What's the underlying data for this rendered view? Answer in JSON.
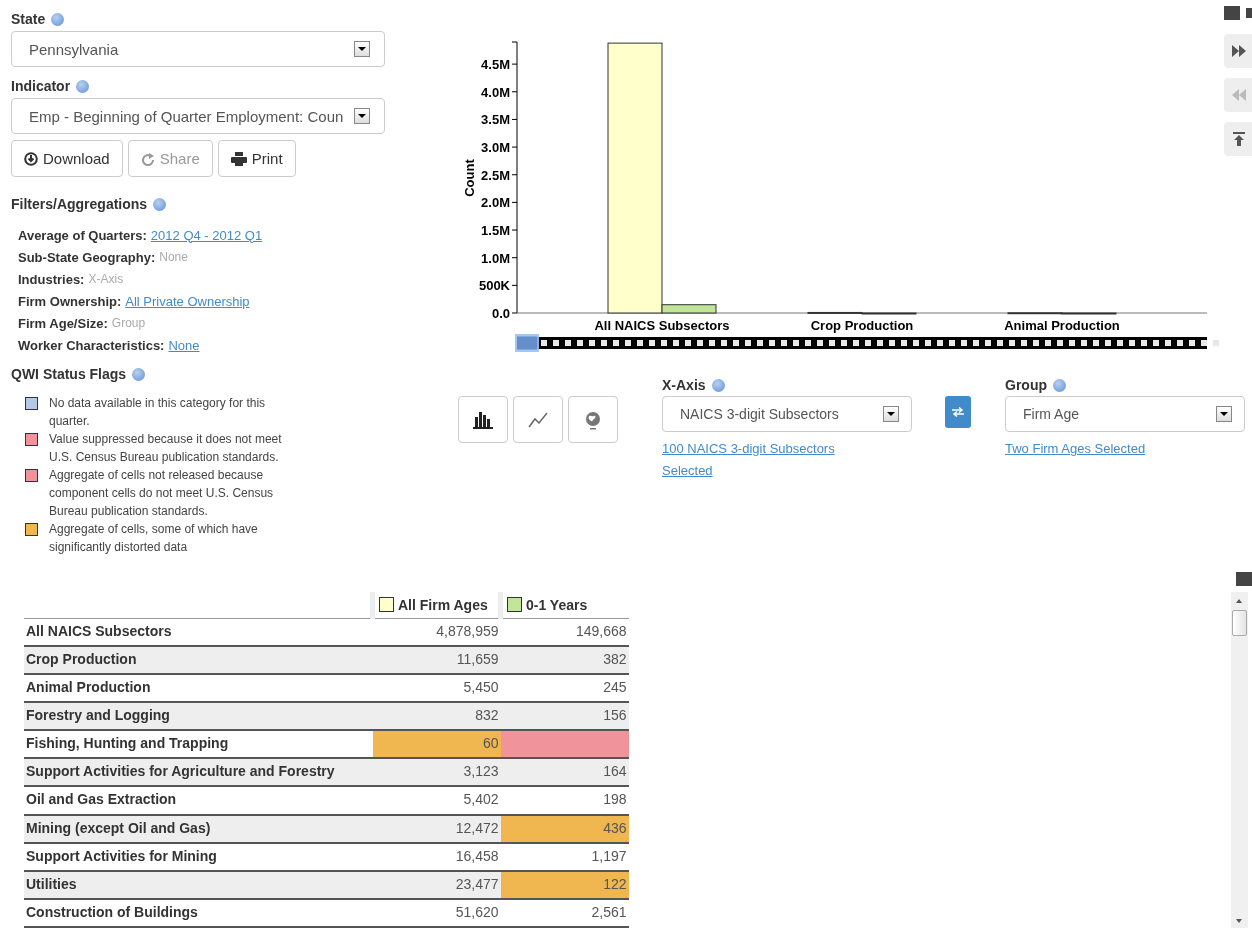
{
  "state_select": {
    "label": "State",
    "value": "Pennsylvania"
  },
  "indicator_select": {
    "label": "Indicator",
    "value": "Emp - Beginning of Quarter Employment: Coun"
  },
  "actions": [
    {
      "label": "Download",
      "kind": "download",
      "disabled": false
    },
    {
      "label": "Share",
      "kind": "share",
      "disabled": true
    },
    {
      "label": "Print",
      "kind": "print",
      "disabled": false
    }
  ],
  "filters": {
    "title": "Filters/Aggregations",
    "items": [
      {
        "label": "Average of Quarters:",
        "value": "2012 Q4 - 2012 Q1",
        "kind": "link"
      },
      {
        "label": "Sub-State Geography:",
        "value": "None",
        "kind": "plain"
      },
      {
        "label": "Industries:",
        "value": "X-Axis",
        "kind": "plain"
      },
      {
        "label": "Firm Ownership:",
        "value": "All Private Ownership",
        "kind": "link"
      },
      {
        "label": "Firm Age/Size:",
        "value": "Group",
        "kind": "plain"
      },
      {
        "label": "Worker Characteristics:",
        "value": "None",
        "kind": "link"
      }
    ]
  },
  "status_flags": {
    "title": "QWI Status Flags",
    "items": [
      {
        "color": "#b4c8ea",
        "text": "No data available in this category for this quarter."
      },
      {
        "color": "#f0939a",
        "text": "Value suppressed because it does not meet U.S. Census Bureau publication standards."
      },
      {
        "color": "#f0939a",
        "text": "Aggregate of cells not released because component cells do not meet U.S. Census Bureau publication standards."
      },
      {
        "color": "#f0b650",
        "text": "Aggregate of cells, some of which have significantly distorted data"
      }
    ]
  },
  "chart": {
    "chart_data": {
      "type": "bar",
      "ylabel": "Count",
      "categories": [
        "All NAICS Subsectors",
        "Crop Production",
        "Animal Production"
      ],
      "series": [
        {
          "name": "All Firm Ages",
          "color": "#ffffcc",
          "values": [
            4880000,
            10000,
            5000
          ]
        },
        {
          "name": "0-1 Years",
          "color": "#c2e699",
          "values": [
            150000,
            0,
            0
          ]
        }
      ],
      "ylim": [
        0,
        4900000
      ],
      "yticks": [
        {
          "value": 0,
          "label": "0.0"
        },
        {
          "value": 500000,
          "label": "500K"
        },
        {
          "value": 1000000,
          "label": "1.0M"
        },
        {
          "value": 1500000,
          "label": "1.5M"
        },
        {
          "value": 2000000,
          "label": "2.0M"
        },
        {
          "value": 2500000,
          "label": "2.5M"
        },
        {
          "value": 3000000,
          "label": "3.0M"
        },
        {
          "value": 3500000,
          "label": "3.5M"
        },
        {
          "value": 4000000,
          "label": "4.0M"
        },
        {
          "value": 4500000,
          "label": "4.5M"
        }
      ]
    }
  },
  "chart_types": [
    {
      "kind": "bar"
    },
    {
      "kind": "line"
    },
    {
      "kind": "map"
    }
  ],
  "x_axis": {
    "label": "X-Axis",
    "value": "NAICS 3-digit Subsectors",
    "link": "100 NAICS 3-digit Subsectors Selected"
  },
  "group": {
    "label": "Group",
    "value": "Firm Age",
    "link": "Two Firm Ages Selected"
  },
  "table": {
    "rows": [
      {
        "name": "All NAICS Subsectors",
        "cells": [
          {
            "value": "4,878,959"
          },
          {
            "value": "149,668"
          }
        ]
      },
      {
        "name": "Crop Production",
        "cells": [
          {
            "value": "11,659"
          },
          {
            "value": "382"
          }
        ]
      },
      {
        "name": "Animal Production",
        "cells": [
          {
            "value": "5,450"
          },
          {
            "value": "245"
          }
        ]
      },
      {
        "name": "Forestry and Logging",
        "cells": [
          {
            "value": "832"
          },
          {
            "value": "156"
          }
        ]
      },
      {
        "name": "Fishing, Hunting and Trapping",
        "cells": [
          {
            "value": "60",
            "color": "#f0b650"
          },
          {
            "color": "#f0939a"
          }
        ]
      },
      {
        "name": "Support Activities for Agriculture and Forestry",
        "cells": [
          {
            "value": "3,123"
          },
          {
            "value": "164"
          }
        ]
      },
      {
        "name": "Oil and Gas Extraction",
        "cells": [
          {
            "value": "5,402"
          },
          {
            "value": "198"
          }
        ]
      },
      {
        "name": "Mining (except Oil and Gas)",
        "cells": [
          {
            "value": "12,472"
          },
          {
            "value": "436",
            "color": "#f0b650"
          }
        ]
      },
      {
        "name": "Support Activities for Mining",
        "cells": [
          {
            "value": "16,458"
          },
          {
            "value": "1,197"
          }
        ]
      },
      {
        "name": "Utilities",
        "cells": [
          {
            "value": "23,477"
          },
          {
            "value": "122",
            "color": "#f0b650"
          }
        ]
      },
      {
        "name": "Construction of Buildings",
        "cells": [
          {
            "value": "51,620"
          },
          {
            "value": "2,561"
          }
        ]
      }
    ]
  }
}
